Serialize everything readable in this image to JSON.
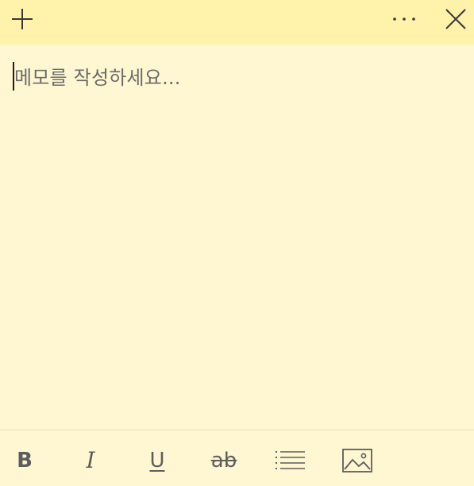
{
  "titlebar": {
    "add_icon": "plus-icon",
    "more_icon": "ellipsis-icon",
    "close_icon": "close-icon"
  },
  "editor": {
    "placeholder": "메모를 작성하세요..."
  },
  "toolbar": {
    "bold_label": "B",
    "italic_label": "I",
    "underline_label": "U",
    "strike_label": "ab",
    "list_icon": "bullet-list-icon",
    "image_icon": "image-icon"
  },
  "colors": {
    "titlebar_bg": "#fff2ab",
    "note_bg": "#fff7d1",
    "icon": "#5d5d5d"
  }
}
